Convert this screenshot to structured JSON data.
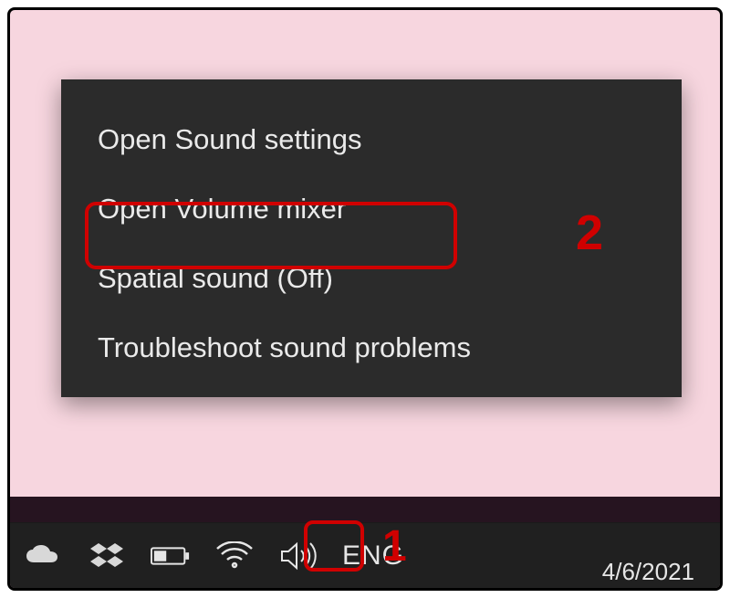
{
  "context_menu": {
    "open_sound_settings": "Open Sound settings",
    "open_volume_mixer": "Open Volume mixer",
    "spatial_sound": "Spatial sound (Off)",
    "troubleshoot": "Troubleshoot sound problems"
  },
  "taskbar": {
    "lang": "ENG",
    "date": "4/6/2021"
  },
  "callouts": {
    "step1": "1",
    "step2": "2"
  },
  "colors": {
    "highlight": "#d00000",
    "menu_bg": "#2b2b2b",
    "desktop_bg": "#f7d6df"
  }
}
